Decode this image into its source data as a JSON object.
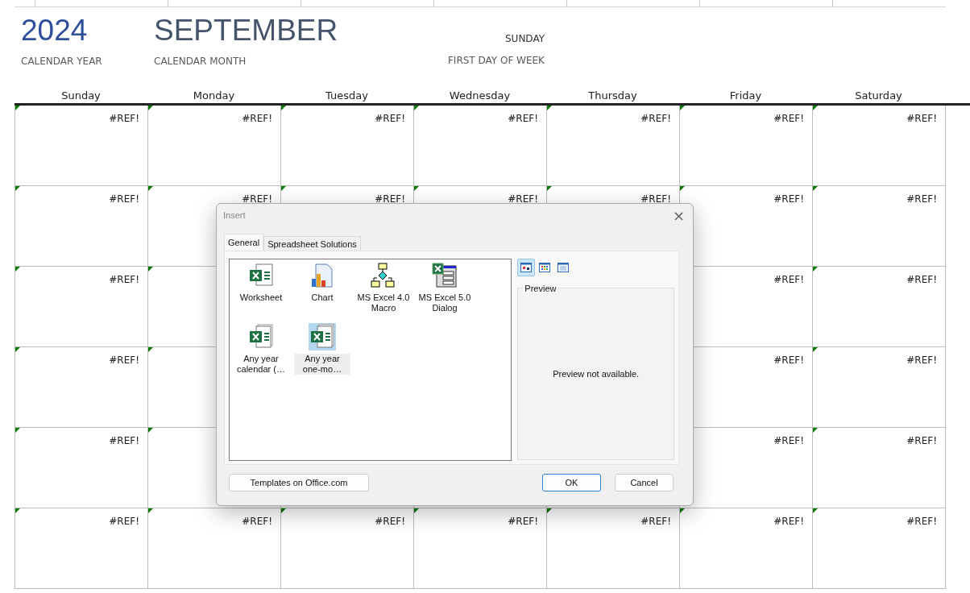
{
  "header": {
    "year": "2024",
    "year_label": "CALENDAR YEAR",
    "month": "SEPTEMBER",
    "month_label": "CALENDAR MONTH",
    "first_day": "SUNDAY",
    "first_day_label": "FIRST DAY OF WEEK"
  },
  "weekdays": [
    "Sunday",
    "Monday",
    "Tuesday",
    "Wednesday",
    "Thursday",
    "Friday",
    "Saturday"
  ],
  "weeks": [
    {
      "start": [
        "#REF!",
        "#REF!",
        "#REF!",
        "#REF!",
        "#REF!",
        "#REF!",
        "#REF!"
      ]
    },
    {
      "start": [
        "#REF!",
        "#REF!",
        "#REF!",
        "#REF!",
        "#REF!",
        "#REF!",
        "#REF!"
      ]
    },
    {
      "start": [
        "#REF!"
      ],
      "end": [
        "#REF!",
        "#REF!"
      ]
    },
    {
      "start": [
        "#REF!"
      ],
      "end": [
        "#REF!",
        "#REF!"
      ]
    },
    {
      "start": [
        "#REF!"
      ],
      "end": [
        "#REF!",
        "#REF!"
      ]
    },
    {
      "start": [
        "#REF!",
        "#REF!",
        "#REF!",
        "#REF!",
        "#REF!",
        "#REF!",
        "#REF!"
      ]
    }
  ],
  "dialog": {
    "title": "Insert",
    "close": "×",
    "tabs": [
      {
        "label": "General",
        "selected": true
      },
      {
        "label": "Spreadsheet Solutions",
        "selected": false
      }
    ],
    "items": [
      {
        "kind": "worksheet",
        "label": "Worksheet",
        "selected": false
      },
      {
        "kind": "chart",
        "label": "Chart",
        "selected": false
      },
      {
        "kind": "macro",
        "label": "MS Excel 4.0 Macro",
        "selected": false
      },
      {
        "kind": "dialog",
        "label": "MS Excel 5.0 Dialog",
        "selected": false
      },
      {
        "kind": "template",
        "label": "Any year calendar (…",
        "selected": false
      },
      {
        "kind": "template",
        "label": "Any year one-mo…",
        "selected": true
      }
    ],
    "views": [
      {
        "kind": "large",
        "selected": true
      },
      {
        "kind": "list",
        "selected": false
      },
      {
        "kind": "details",
        "selected": false
      }
    ],
    "preview": {
      "legend": "Preview",
      "message": "Preview not available."
    },
    "buttons": [
      {
        "kind": "link",
        "label": "Templates on Office.com"
      },
      {
        "kind": "default",
        "label": "OK"
      },
      {
        "kind": "plain",
        "label": "Cancel"
      }
    ]
  }
}
